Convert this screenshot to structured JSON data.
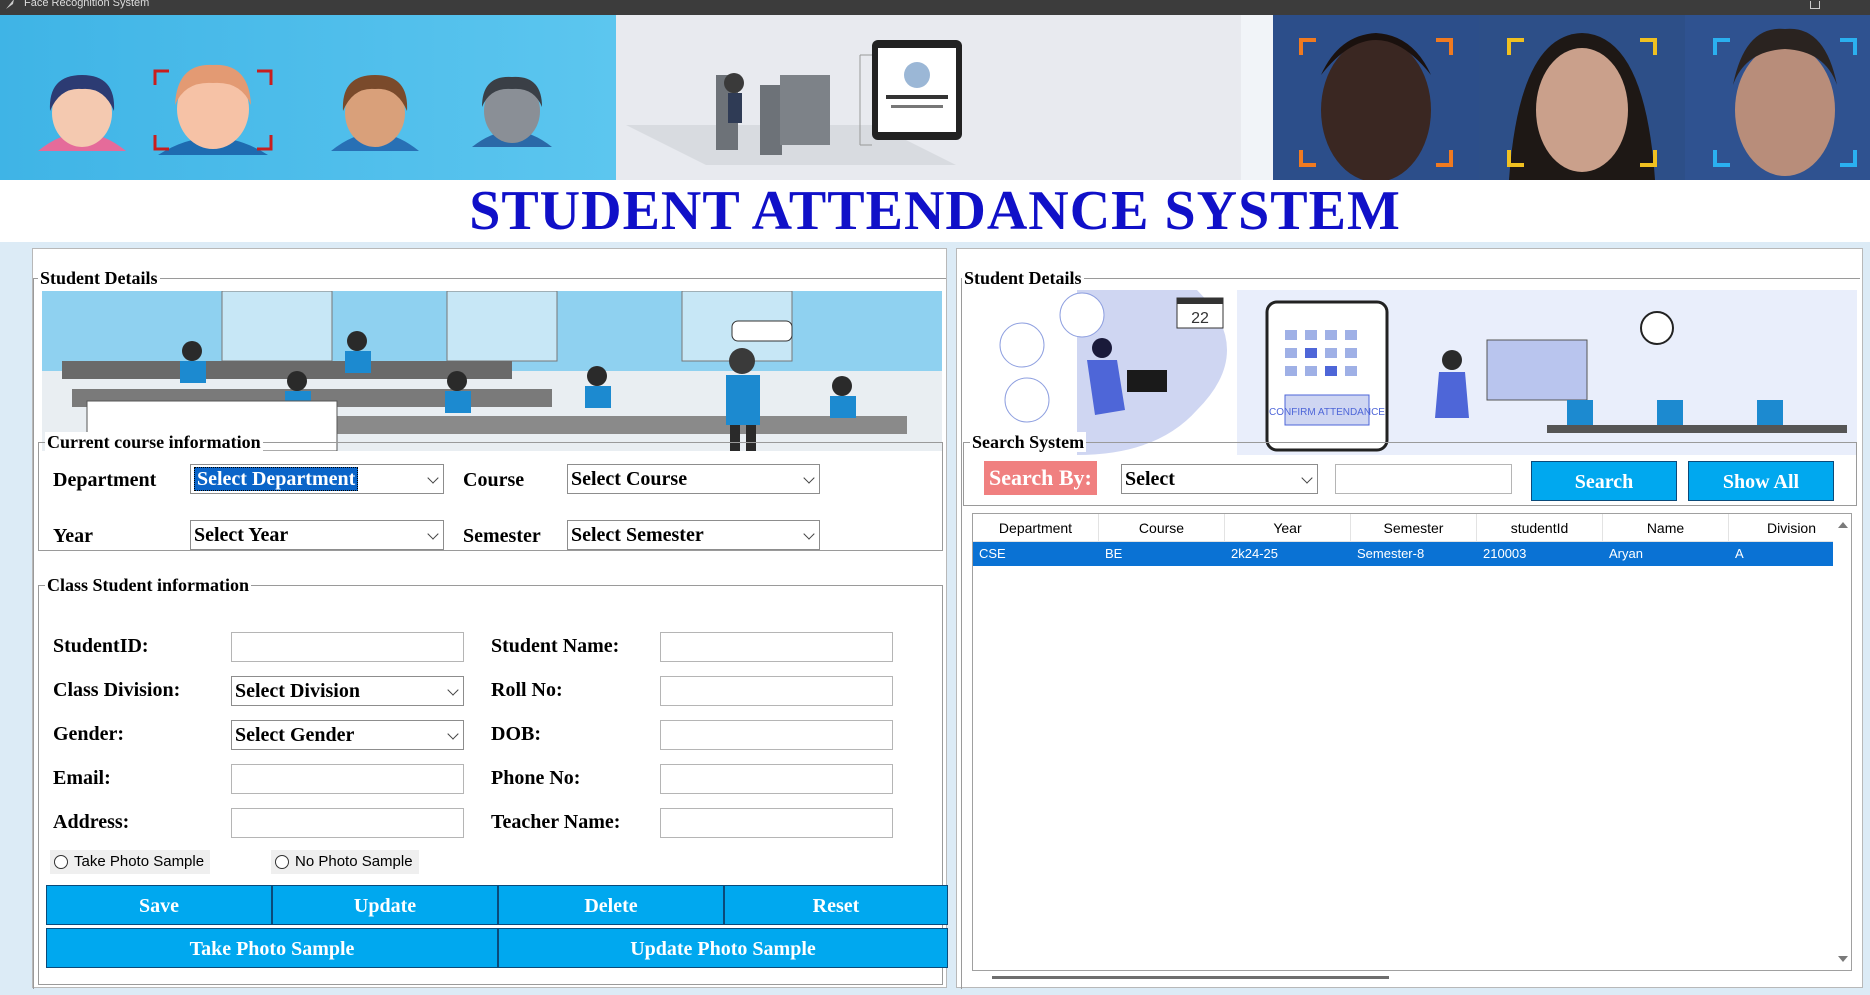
{
  "window": {
    "title": "Face Recognition System"
  },
  "main_title": "STUDENT ATTENDANCE SYSTEM",
  "left_panel": {
    "label": "Student Details",
    "course_info": {
      "label": "Current course information",
      "department_label": "Department",
      "department_value": "Select Department",
      "course_label": "Course",
      "course_value": "Select Course",
      "year_label": "Year",
      "year_value": "Select Year",
      "semester_label": "Semester",
      "semester_value": "Select Semester"
    },
    "class_info": {
      "label": "Class Student information",
      "student_id_label": "StudentID:",
      "student_name_label": "Student Name:",
      "class_division_label": "Class Division:",
      "class_division_value": "Select Division",
      "roll_no_label": "Roll No:",
      "gender_label": "Gender:",
      "gender_value": "Select Gender",
      "dob_label": "DOB:",
      "email_label": "Email:",
      "phone_label": "Phone No:",
      "address_label": "Address:",
      "teacher_label": "Teacher Name:",
      "radio_take": "Take Photo Sample",
      "radio_no": "No Photo Sample"
    },
    "buttons": {
      "save": "Save",
      "update": "Update",
      "delete": "Delete",
      "reset": "Reset",
      "take_photo": "Take Photo Sample",
      "update_photo": "Update Photo Sample"
    }
  },
  "right_panel": {
    "label": "Student Details",
    "calendar_day": "22",
    "confirm_text": "CONFIRM ATTENDANCE",
    "search": {
      "label": "Search System",
      "search_by": "Search By:",
      "select_value": "Select",
      "search_button": "Search",
      "show_all_button": "Show All"
    },
    "table": {
      "columns": [
        "Department",
        "Course",
        "Year",
        "Semester",
        "studentId",
        "Name",
        "Division"
      ],
      "rows": [
        [
          "CSE",
          "BE",
          "2k24-25",
          "Semester-8",
          "210003",
          "Aryan",
          "A"
        ]
      ]
    }
  },
  "colors": {
    "title_blue": "#1010c8",
    "button_blue": "#00a8ef",
    "row_selected": "#0a72d4",
    "search_by_bg": "#f08080"
  }
}
